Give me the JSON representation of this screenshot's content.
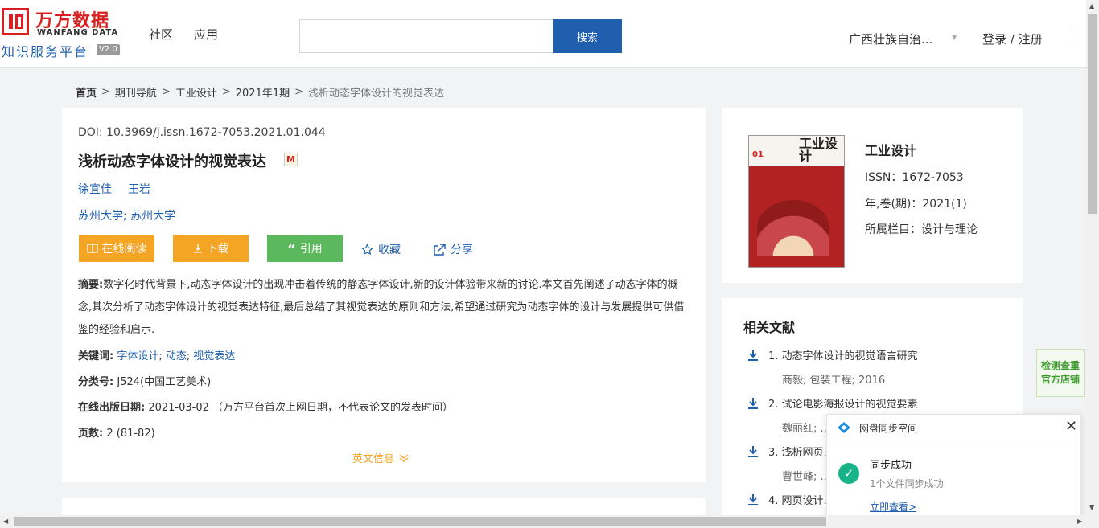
{
  "header": {
    "logo_cn": "万方数据",
    "logo_en": "WANFANG DATA",
    "logo_sub": "知识服务平台",
    "logo_version": "V2.0",
    "nav": [
      "社区",
      "应用"
    ],
    "search_value": "",
    "search_button": "搜索",
    "region": "广西壮族自治...",
    "login": "登录 / 注册"
  },
  "breadcrumb": [
    "首页",
    "期刊导航",
    "工业设计",
    "2021年1期",
    "浅析动态字体设计的视觉表达"
  ],
  "article": {
    "doi": "DOI: 10.3969/j.issn.1672-7053.2021.01.044",
    "title": "浅析动态字体设计的视觉表达",
    "title_badge": "M",
    "authors": [
      "徐宜佳",
      "王岩"
    ],
    "orgs": "苏州大学; 苏州大学",
    "actions": {
      "read": "在线阅读",
      "download": "下载",
      "cite": "引用",
      "favorite": "收藏",
      "share": "分享"
    },
    "abstract_label": "摘要:",
    "abstract": "数字化时代背景下,动态字体设计的出现冲击着传统的静态字体设计,新的设计体验带来新的讨论.本文首先阐述了动态字体的概念,其次分析了动态字体设计的视觉表达特征,最后总结了其视觉表达的原则和方法,希望通过研究为动态字体的设计与发展提供可供借鉴的经验和启示.",
    "keywords_label": "关键词:",
    "keywords": [
      "字体设计",
      "动态",
      "视觉表达"
    ],
    "class_label": "分类号:",
    "class_value": "J524(中国工艺美术)",
    "pub_date_label": "在线出版日期:",
    "pub_date_value": "2021-03-02  （万方平台首次上网日期，不代表论文的发表时间）",
    "pages_label": "页数:",
    "pages_value": "2 (81-82)",
    "english_info": "英文信息"
  },
  "journal": {
    "cover_num": "01",
    "cover_title": "工业设计",
    "name": "工业设计",
    "issn": "ISSN：1672-7053",
    "year_vol": "年,卷(期)：2021(1)",
    "column": "所属栏目：设计与理论"
  },
  "related": {
    "title": "相关文献",
    "items": [
      {
        "label": "1. 动态字体设计的视觉语言研究",
        "meta": "商毅; 包装工程;  2016"
      },
      {
        "label": "2. 试论电影海报设计的视觉要素",
        "meta": "魏丽红; ..."
      },
      {
        "label": "3. 浅析网页...",
        "meta": "曹世峰; ..."
      },
      {
        "label": "4. 网页设计...",
        "meta": ""
      }
    ]
  },
  "float_tab": [
    "检测查重",
    "官方店铺"
  ],
  "popup": {
    "title": "网盘同步空间",
    "message": "同步成功",
    "sub": "1个文件同步成功",
    "link": "立即查看>"
  },
  "colors": {
    "brand_red": "#d7201f",
    "link_blue": "#1f5fae",
    "orange": "#f5a524",
    "green": "#5cb85c"
  }
}
